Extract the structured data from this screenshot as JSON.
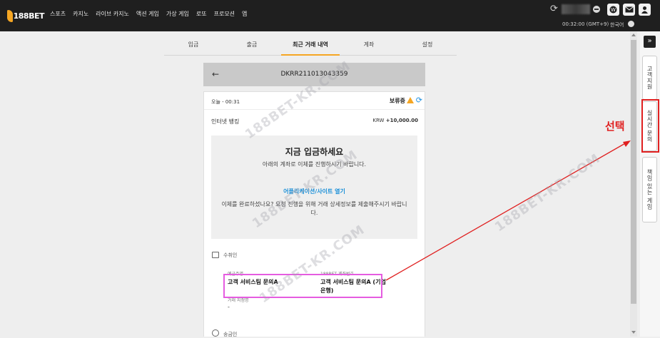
{
  "header": {
    "logo_text": "188BET",
    "nav": [
      "스포츠",
      "카지노",
      "라이브 카지노",
      "액션 게임",
      "가상 게임",
      "로또",
      "프로모션",
      "앱"
    ],
    "clock": "00:32:00 (GMT+9)",
    "language": "한국어"
  },
  "tabs": [
    {
      "label": "입금",
      "active": false
    },
    {
      "label": "출금",
      "active": false
    },
    {
      "label": "최근 거래 내역",
      "active": true
    },
    {
      "label": "계좌",
      "active": false
    },
    {
      "label": "설정",
      "active": false
    }
  ],
  "transaction": {
    "reference": "DKRR211013043359",
    "time": "오늘 - 00:31",
    "status": "보류중",
    "method": "인터넷 뱅킹",
    "currency": "KRW",
    "amount": "+10,000.00"
  },
  "deposit_box": {
    "title": "지금 입금하세요",
    "subtitle": "아래의 계좌로 이체를 진행하시기 바랍니다.",
    "link": "어플리케이션/사이트 열기",
    "note": "이체를 완료하셨나요? 요청 진행을 위해 거래 상세정보를 제출해주시기 바랍니다."
  },
  "recipient": {
    "section_label": "수취인",
    "holder_label": "예금주명",
    "holder_value": "고객 서비스팀 문의A",
    "account_label": "188BET 계좌번호",
    "account_value": "고객 서비스팀 문의A (기업 은행)",
    "branch_label": "거래 지점명",
    "branch_value": "-",
    "next_section_label": "송금인"
  },
  "side_panel": {
    "items": [
      "고객지원",
      "실시간 문의",
      "책임 있는 게임"
    ]
  },
  "annotation": {
    "text": "선택",
    "color": "#e02020"
  },
  "colors": {
    "accent": "#f5a623",
    "link": "#1a8fd8",
    "highlight": "#e55ce0",
    "annotation": "#e02020"
  },
  "watermark": "188BET-KR.COM"
}
